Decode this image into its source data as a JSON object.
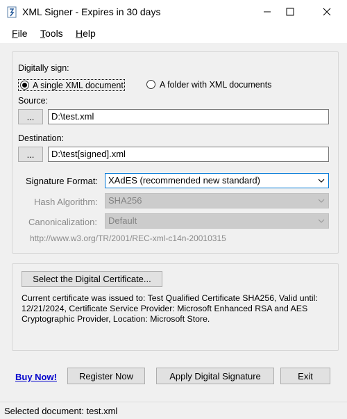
{
  "window": {
    "title": "XML Signer - Expires in 30 days",
    "minimize_icon": "minimize-icon",
    "maximize_icon": "maximize-icon",
    "close_icon": "close-icon"
  },
  "menu": {
    "file": "File",
    "file_acc": "F",
    "file_rest": "ile",
    "tools": "Tools",
    "tools_acc": "T",
    "tools_rest": "ools",
    "help": "Help",
    "help_acc": "H",
    "help_rest": "elp"
  },
  "sign_group": {
    "label": "Digitally sign:",
    "options": [
      {
        "label": "A single XML document",
        "selected": true
      },
      {
        "label": "A folder with XML documents",
        "selected": false
      }
    ],
    "source_label": "Source:",
    "source_value": "D:\\test.xml",
    "destination_label": "Destination:",
    "destination_value": "D:\\test[signed].xml",
    "browse_label": "...",
    "signature_format_label": "Signature Format:",
    "signature_format_value": "XAdES (recommended new standard)",
    "hash_algorithm_label": "Hash Algorithm:",
    "hash_algorithm_value": "SHA256",
    "canonicalization_label": "Canonicalization:",
    "canonicalization_value": "Default",
    "canonicalization_url": "http://www.w3.org/TR/2001/REC-xml-c14n-20010315"
  },
  "cert_group": {
    "select_button": "Select the Digital Certificate...",
    "info_line1": "Current certificate was issued to: Test Qualified Certificate SHA256, Valid until:",
    "info_line2": "12/21/2024, Certificate Service Provider: Microsoft Enhanced RSA and AES",
    "info_line3": "Cryptographic Provider, Location: Microsoft Store."
  },
  "actions": {
    "buy_now": "Buy Now!",
    "register_now": "Register Now",
    "apply_signature": "Apply Digital Signature",
    "exit": "Exit"
  },
  "status": {
    "text": "Selected document: test.xml"
  },
  "colors": {
    "link": "#0000cc",
    "focus_border": "#0078d7",
    "disabled_bg": "#cccccc",
    "disabled_text": "#8a8a8a"
  }
}
